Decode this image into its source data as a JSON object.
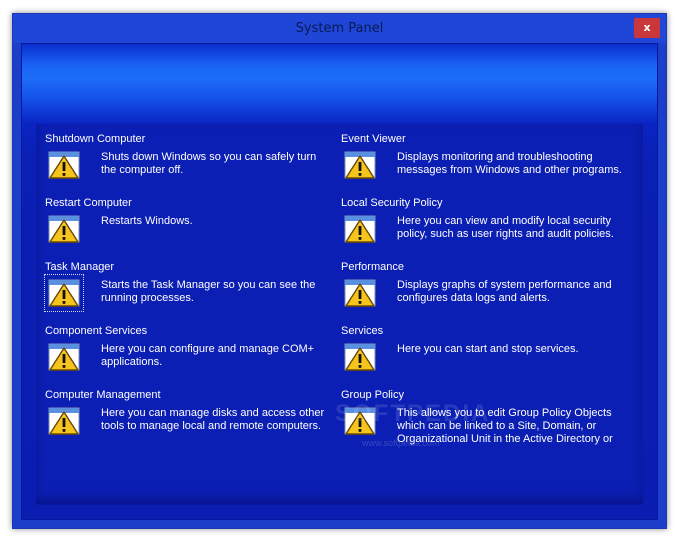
{
  "window": {
    "title": "System Panel",
    "close_label": "x"
  },
  "items": [
    {
      "title": "Shutdown Computer",
      "desc": "Shuts down Windows so you can safely turn the computer off."
    },
    {
      "title": "Event Viewer",
      "desc": "Displays monitoring and troubleshooting messages from Windows and other programs."
    },
    {
      "title": "Restart Computer",
      "desc": "Restarts Windows."
    },
    {
      "title": "Local Security Policy",
      "desc": "Here you can view and modify local security policy, such as user rights and audit policies."
    },
    {
      "title": "Task Manager",
      "desc": "Starts the Task Manager so you can see the running processes."
    },
    {
      "title": "Performance",
      "desc": "Displays graphs of system performance and configures data logs and alerts."
    },
    {
      "title": "Component Services",
      "desc": "Here you can configure and manage COM+ applications."
    },
    {
      "title": "Services",
      "desc": "Here you can start and stop services."
    },
    {
      "title": "Computer Management",
      "desc": "Here you can manage disks and access other tools to manage local and remote computers."
    },
    {
      "title": "Group Policy",
      "desc": "This allows you to edit Group Policy Objects which can be linked to a Site, Domain, or Organizational Unit in the Active Directory or"
    }
  ],
  "icon": "warning-window-icon",
  "watermark": {
    "text": "SOFTPEDIA",
    "url_text": "www.softpedia.com"
  },
  "colors": {
    "accent": "#1a64f5",
    "background": "#0a1fb3",
    "close": "#c8383b"
  }
}
